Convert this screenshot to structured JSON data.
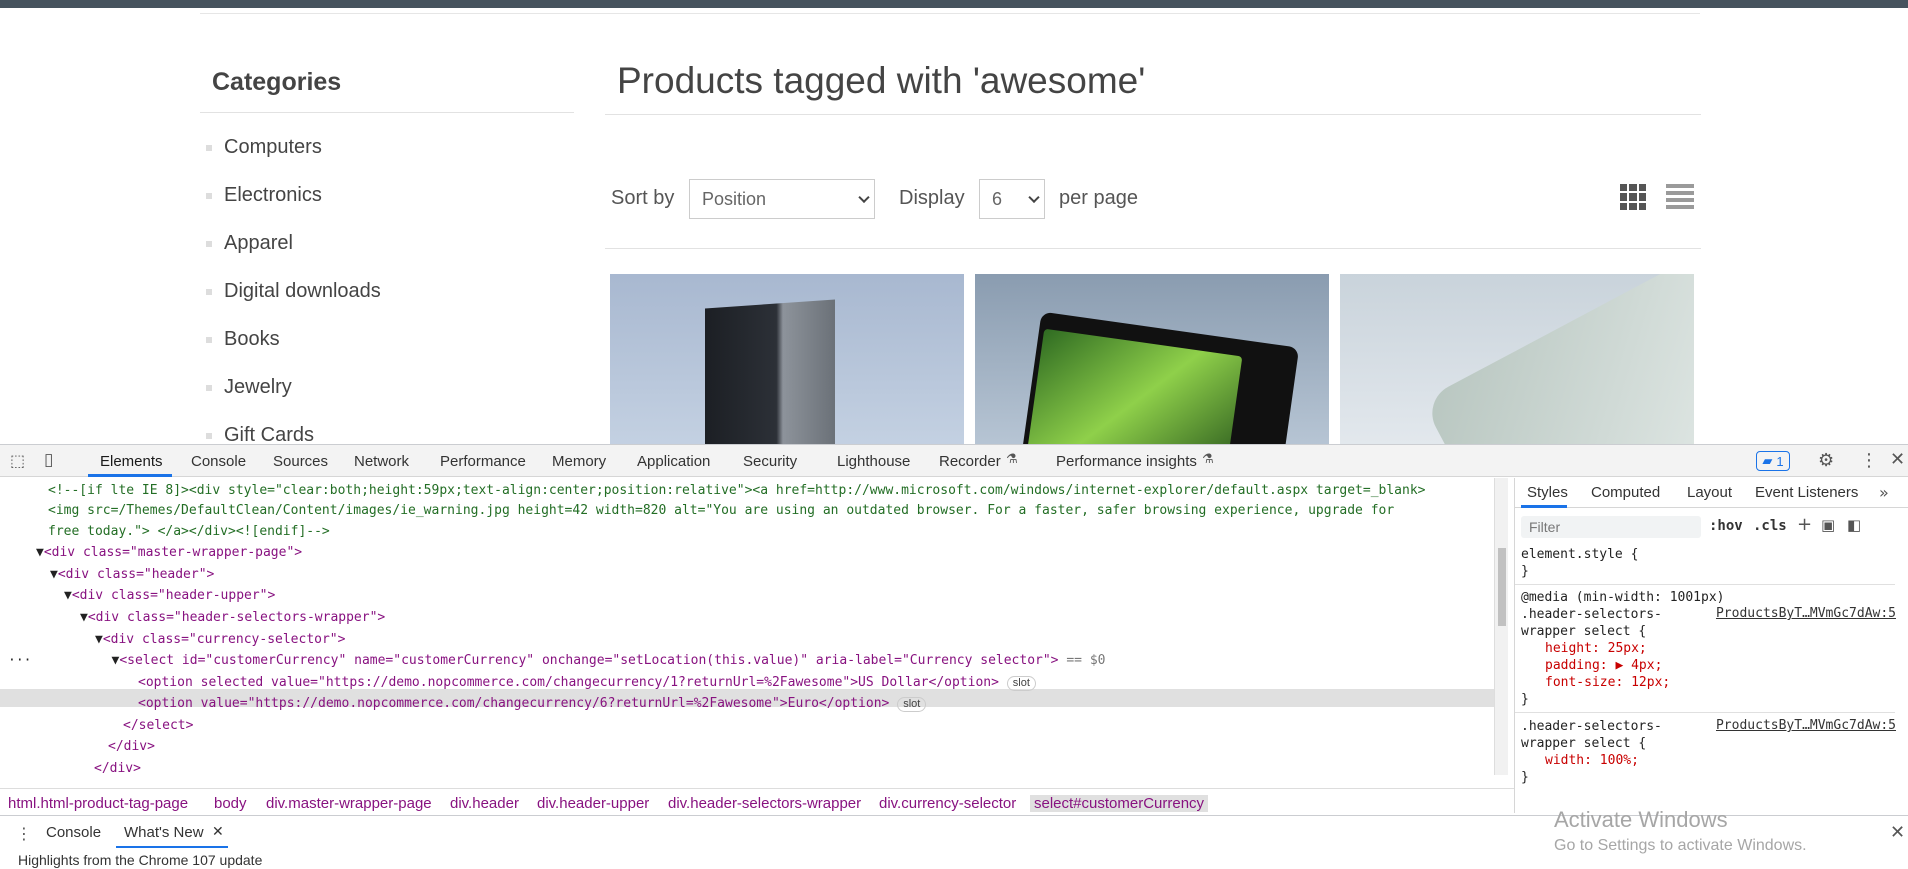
{
  "sidebar": {
    "title": "Categories",
    "items": [
      "Computers",
      "Electronics",
      "Apparel",
      "Digital downloads",
      "Books",
      "Jewelry",
      "Gift Cards"
    ]
  },
  "main": {
    "title": "Products tagged with 'awesome'",
    "sort_label": "Sort by",
    "sort_value": "Position",
    "display_label": "Display",
    "display_value": "6",
    "per_page_label": "per page"
  },
  "devtools": {
    "tabs": [
      "Elements",
      "Console",
      "Sources",
      "Network",
      "Performance",
      "Memory",
      "Application",
      "Security",
      "Lighthouse",
      "Recorder",
      "Performance insights"
    ],
    "issues_count": "1",
    "dom_lines": {
      "l1": "<!--[if lte IE 8]><div style=\"clear:both;height:59px;text-align:center;position:relative\"><a href=http://www.microsoft.com/windows/internet-explorer/default.aspx target=_blank>",
      "l2": "<img src=/Themes/DefaultClean/Content/images/ie_warning.jpg height=42 width=820 alt=\"You are using an outdated browser. For a faster, safer browsing experience, upgrade for",
      "l3": "free today.\"> </a></div><![endif]-->",
      "l4": "<div class=\"master-wrapper-page\">",
      "l5": "<div class=\"header\">",
      "l6": "<div class=\"header-upper\">",
      "l7": "<div class=\"header-selectors-wrapper\">",
      "l8": "<div class=\"currency-selector\">",
      "l9": "<select id=\"customerCurrency\" name=\"customerCurrency\" onchange=\"setLocation(this.value)\" aria-label=\"Currency selector\">",
      "l9_suffix": "== $0",
      "l10": "<option selected value=\"https://demo.nopcommerce.com/changecurrency/1?returnUrl=%2Fawesome\">US Dollar</option>",
      "l11": "<option value=\"https://demo.nopcommerce.com/changecurrency/6?returnUrl=%2Fawesome\">Euro</option>",
      "l12": "</select>",
      "l13": "</div>",
      "l14": "</div>",
      "slot": "slot"
    },
    "breadcrumbs": [
      "html.html-product-tag-page",
      "body",
      "div.master-wrapper-page",
      "div.header",
      "div.header-upper",
      "div.header-selectors-wrapper",
      "div.currency-selector",
      "select#customerCurrency"
    ],
    "styles_tabs": [
      "Styles",
      "Computed",
      "Layout",
      "Event Listeners"
    ],
    "filter_placeholder": "Filter",
    "hov": ":hov",
    "cls": ".cls",
    "css": {
      "element_style": "element.style {",
      "close": "}",
      "media": "@media (min-width: 1001px)",
      "selector1a": ".header-selectors-",
      "selector1b": "wrapper select {",
      "source1": "ProductsByT…MVmGc7dAw:5",
      "p1": "height: 25px;",
      "p2": "padding: ▶ 4px;",
      "p3": "font-size: 12px;",
      "selector2a": ".header-selectors-",
      "selector2b": "wrapper select {",
      "source2": "ProductsByT…MVmGc7dAw:5",
      "p4": "width: 100%;"
    },
    "drawer_tabs": [
      "Console",
      "What's New"
    ],
    "drawer_text": "Highlights from the Chrome 107 update"
  },
  "os": {
    "watermark_title": "Activate Windows",
    "watermark_sub": "Go to Settings to activate Windows."
  }
}
